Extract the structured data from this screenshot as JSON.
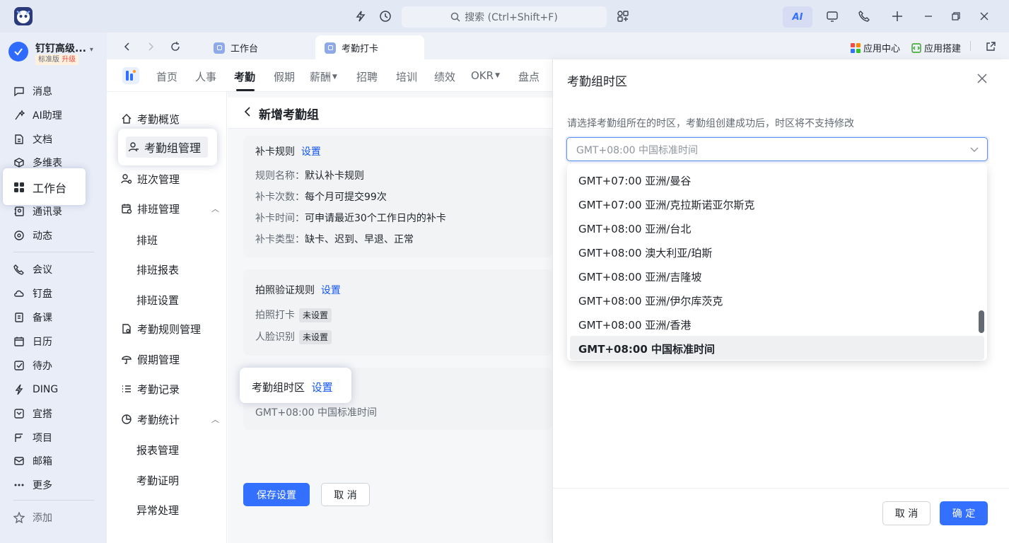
{
  "titlebar": {
    "search_placeholder": "搜索 (Ctrl+Shift+F)",
    "ai_label": "AI"
  },
  "org": {
    "name": "钉钉高级...",
    "edition": "标准版",
    "upgrade": "升级"
  },
  "sidebar": {
    "items": [
      {
        "label": "消息",
        "icon": "message-icon"
      },
      {
        "label": "AI助理",
        "icon": "ai-assistant-icon"
      },
      {
        "label": "文档",
        "icon": "document-icon"
      },
      {
        "label": "多维表",
        "icon": "table-icon"
      },
      {
        "label": "工作台",
        "icon": "workbench-icon"
      },
      {
        "label": "通讯录",
        "icon": "contacts-icon"
      },
      {
        "label": "动态",
        "icon": "feed-icon"
      },
      {
        "label": "会议",
        "icon": "meeting-icon"
      },
      {
        "label": "钉盘",
        "icon": "cloud-drive-icon"
      },
      {
        "label": "备课",
        "icon": "lesson-icon"
      },
      {
        "label": "日历",
        "icon": "calendar-icon"
      },
      {
        "label": "待办",
        "icon": "todo-icon"
      },
      {
        "label": "DING",
        "icon": "ding-icon"
      },
      {
        "label": "宜搭",
        "icon": "yida-icon"
      },
      {
        "label": "项目",
        "icon": "project-icon"
      },
      {
        "label": "邮箱",
        "icon": "mail-icon"
      },
      {
        "label": "更多",
        "icon": "more-icon"
      },
      {
        "label": "添加",
        "icon": "add-pin-icon"
      }
    ]
  },
  "tabs": [
    {
      "label": "工作台"
    },
    {
      "label": "考勤打卡"
    }
  ],
  "tabbar_right": {
    "app_center": "应用中心",
    "app_builder": "应用搭建"
  },
  "app_nav": {
    "items": [
      "首页",
      "人事",
      "考勤",
      "假期",
      "薪酬",
      "招聘",
      "培训",
      "绩效",
      "OKR",
      "盘点"
    ]
  },
  "sub_nav": {
    "overview": "考勤概览",
    "group_mgmt": "考勤组管理",
    "shift_mgmt": "班次管理",
    "schedule_mgmt": "排班管理",
    "schedule": "排班",
    "schedule_report": "排班报表",
    "schedule_settings": "排班设置",
    "rule_mgmt": "考勤规则管理",
    "leave_mgmt": "假期管理",
    "records": "考勤记录",
    "stats": "考勤统计",
    "report_mgmt": "报表管理",
    "certificate": "考勤证明",
    "exception": "异常处理"
  },
  "page": {
    "title": "新增考勤组",
    "makeup": {
      "title": "补卡规则",
      "set": "设置",
      "rows": [
        {
          "k": "规则名称：",
          "v": "默认补卡规则"
        },
        {
          "k": "补卡次数：",
          "v": "每个月可提交99次"
        },
        {
          "k": "补卡时间：",
          "v": "可申请最近30个工作日内的补卡"
        },
        {
          "k": "补卡类型：",
          "v": "缺卡、迟到、早退、正常"
        }
      ]
    },
    "photo": {
      "title": "拍照验证规则",
      "set": "设置",
      "rows": [
        {
          "k": "拍照打卡",
          "v": "未设置"
        },
        {
          "k": "人脸识别",
          "v": "未设置"
        }
      ]
    },
    "timezone": {
      "title": "考勤组时区",
      "set": "设置",
      "value": "GMT+08:00 中国标准时间"
    },
    "save": "保存设置",
    "cancel": "取 消"
  },
  "drawer": {
    "title": "考勤组时区",
    "description": "请选择考勤组所在的时区，考勤组创建成功后，时区将不支持修改",
    "select_value": "GMT+08:00 中国标准时间",
    "options": [
      "GMT+07:00 亚洲/曼谷",
      "GMT+07:00 亚洲/克拉斯诺亚尔斯克",
      "GMT+08:00 亚洲/台北",
      "GMT+08:00 澳大利亚/珀斯",
      "GMT+08:00 亚洲/吉隆坡",
      "GMT+08:00 亚洲/伊尔库茨克",
      "GMT+08:00 亚洲/香港",
      "GMT+08:00 中国标准时间"
    ],
    "selected_index": 7,
    "cancel": "取 消",
    "confirm": "确 定"
  },
  "colors": {
    "primary": "#3370ff",
    "link": "#1456f0"
  }
}
